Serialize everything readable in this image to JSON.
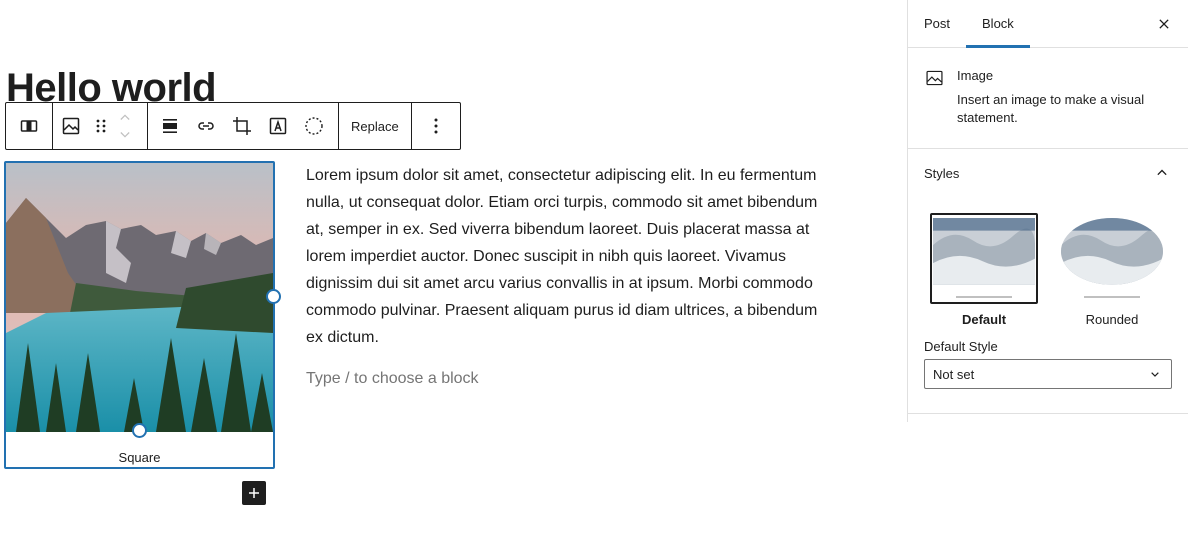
{
  "editor": {
    "title": "Hello world",
    "toolbar": {
      "replace_label": "Replace",
      "icons": [
        "align-wide-icon",
        "image-icon",
        "drag-handle-icon",
        "move-up-icon",
        "move-down-icon",
        "align-center-icon",
        "link-icon",
        "crop-icon",
        "text-overlay-icon",
        "duotone-icon",
        "more-options-icon"
      ]
    },
    "image_block": {
      "caption": "Square"
    },
    "paragraph": "Lorem ipsum dolor sit amet, consectetur adipiscing elit. In eu fermentum nulla, ut consequat dolor. Etiam orci turpis, commodo sit amet bibendum at, semper in ex. Sed viverra bibendum laoreet. Duis placerat massa at lorem imperdiet auctor. Donec suscipit in nibh quis laoreet. Vivamus dignissim dui sit amet arcu varius convallis in at ipsum. Morbi commodo commodo pulvinar. Praesent aliquam purus id diam ultrices, a bibendum ex dictum.",
    "placeholder": "Type / to choose a block"
  },
  "sidebar": {
    "tabs": [
      {
        "label": "Post",
        "active": false
      },
      {
        "label": "Block",
        "active": true
      }
    ],
    "block_card": {
      "title": "Image",
      "description": "Insert an image to make a visual statement."
    },
    "styles_panel": {
      "title": "Styles",
      "expanded": true,
      "options": [
        {
          "label": "Default",
          "selected": true
        },
        {
          "label": "Rounded",
          "selected": false
        }
      ],
      "default_style_label": "Default Style",
      "default_style_value": "Not set"
    }
  },
  "colors": {
    "accent": "#2271b1",
    "text": "#1e1e1e",
    "muted": "#757575",
    "border": "#e0e0e0"
  }
}
